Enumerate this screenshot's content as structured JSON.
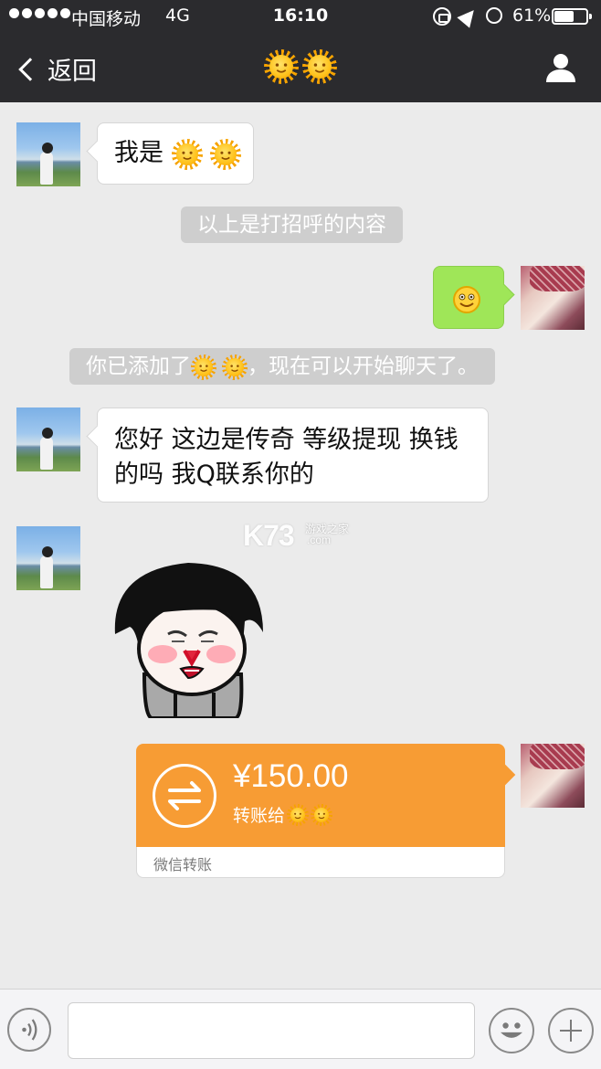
{
  "status_bar": {
    "carrier": "中国移动",
    "network": "4G",
    "time": "16:10",
    "battery_text": "61%",
    "battery_level": 0.61,
    "icons": [
      "orientation-lock-icon",
      "location-icon",
      "alarm-icon",
      "battery-icon"
    ]
  },
  "nav": {
    "back_label": "返回",
    "title_icons": [
      "sun-emoji",
      "sun-emoji"
    ],
    "contact_icon": "person-icon"
  },
  "messages": {
    "m1_text": "我是",
    "sys1": "以上是打招呼的内容",
    "sys2_prefix": "你已添加了",
    "sys2_suffix": "，现在可以开始聊天了。",
    "m3_line1": "您好 这边是传奇 等级提现 换钱",
    "m3_line2": "的吗 我Q联系你的",
    "sticker": "mushroom-head-nosebleed-sticker"
  },
  "transfer": {
    "amount": "¥150.00",
    "to_label": "转账给",
    "footer": "微信转账",
    "icon": "transfer-arrows-icon"
  },
  "watermark": {
    "big": "K73",
    "small": "游戏之家",
    "com": ".com"
  },
  "input_bar": {
    "voice_icon": "voice-icon",
    "emoji_icon": "emoji-icon",
    "plus_icon": "plus-icon",
    "input_value": ""
  },
  "colors": {
    "nav_bg": "#2b2b2e",
    "chat_bg": "#ebebeb",
    "bubble_green": "#9fe658",
    "transfer_orange": "#f79c34",
    "system_bubble": "#cecece"
  }
}
